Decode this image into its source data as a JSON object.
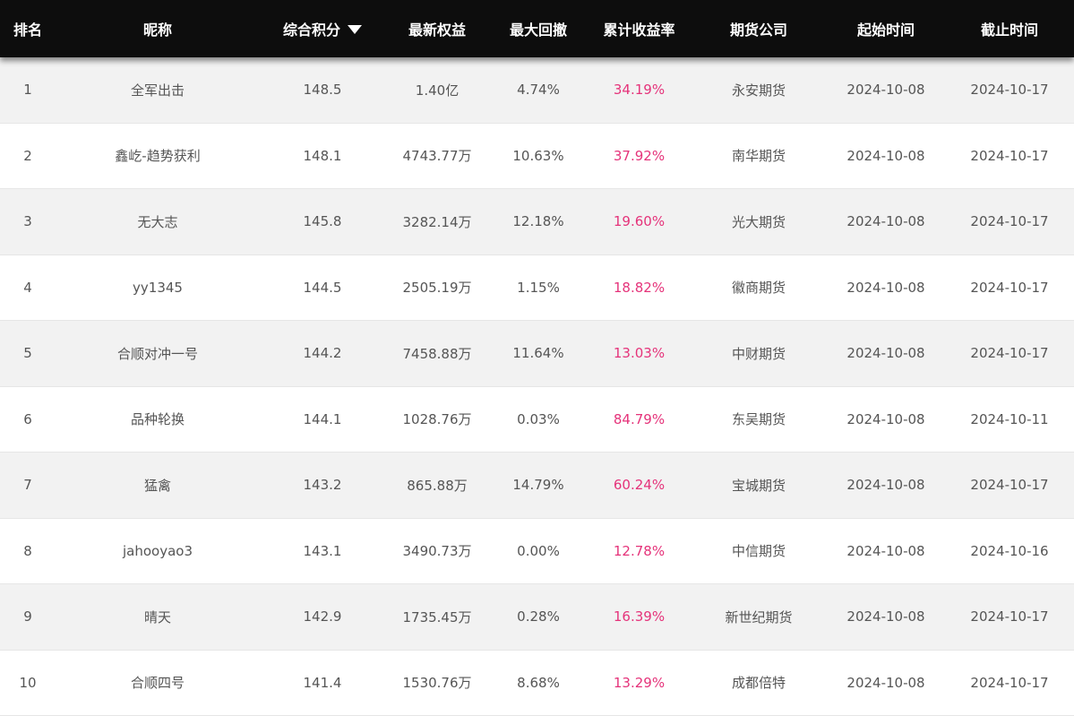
{
  "columns": {
    "rank": "排名",
    "name": "昵称",
    "score": "综合积分",
    "equity": "最新权益",
    "drawdown": "最大回撤",
    "return": "累计收益率",
    "company": "期货公司",
    "start": "起始时间",
    "end": "截止时间"
  },
  "sort_icon": "triangle-down-icon",
  "colors": {
    "header_bg": "#0d0d0d",
    "odd_row_bg": "#f2f2f2",
    "return_text": "#e5337a"
  },
  "rows": [
    {
      "rank": "1",
      "name": "全军出击",
      "score": "148.5",
      "equity": "1.40亿",
      "drawdown": "4.74%",
      "return": "34.19%",
      "company": "永安期货",
      "start": "2024-10-08",
      "end": "2024-10-17"
    },
    {
      "rank": "2",
      "name": "鑫屹-趋势获利",
      "score": "148.1",
      "equity": "4743.77万",
      "drawdown": "10.63%",
      "return": "37.92%",
      "company": "南华期货",
      "start": "2024-10-08",
      "end": "2024-10-17"
    },
    {
      "rank": "3",
      "name": "无大志",
      "score": "145.8",
      "equity": "3282.14万",
      "drawdown": "12.18%",
      "return": "19.60%",
      "company": "光大期货",
      "start": "2024-10-08",
      "end": "2024-10-17"
    },
    {
      "rank": "4",
      "name": "yy1345",
      "score": "144.5",
      "equity": "2505.19万",
      "drawdown": "1.15%",
      "return": "18.82%",
      "company": "徽商期货",
      "start": "2024-10-08",
      "end": "2024-10-17"
    },
    {
      "rank": "5",
      "name": "合顺对冲一号",
      "score": "144.2",
      "equity": "7458.88万",
      "drawdown": "11.64%",
      "return": "13.03%",
      "company": "中财期货",
      "start": "2024-10-08",
      "end": "2024-10-17"
    },
    {
      "rank": "6",
      "name": "品种轮换",
      "score": "144.1",
      "equity": "1028.76万",
      "drawdown": "0.03%",
      "return": "84.79%",
      "company": "东吴期货",
      "start": "2024-10-08",
      "end": "2024-10-11"
    },
    {
      "rank": "7",
      "name": "猛禽",
      "score": "143.2",
      "equity": "865.88万",
      "drawdown": "14.79%",
      "return": "60.24%",
      "company": "宝城期货",
      "start": "2024-10-08",
      "end": "2024-10-17"
    },
    {
      "rank": "8",
      "name": "jahooyao3",
      "score": "143.1",
      "equity": "3490.73万",
      "drawdown": "0.00%",
      "return": "12.78%",
      "company": "中信期货",
      "start": "2024-10-08",
      "end": "2024-10-16"
    },
    {
      "rank": "9",
      "name": "晴天",
      "score": "142.9",
      "equity": "1735.45万",
      "drawdown": "0.28%",
      "return": "16.39%",
      "company": "新世纪期货",
      "start": "2024-10-08",
      "end": "2024-10-17"
    },
    {
      "rank": "10",
      "name": "合顺四号",
      "score": "141.4",
      "equity": "1530.76万",
      "drawdown": "8.68%",
      "return": "13.29%",
      "company": "成都倍特",
      "start": "2024-10-08",
      "end": "2024-10-17"
    }
  ]
}
